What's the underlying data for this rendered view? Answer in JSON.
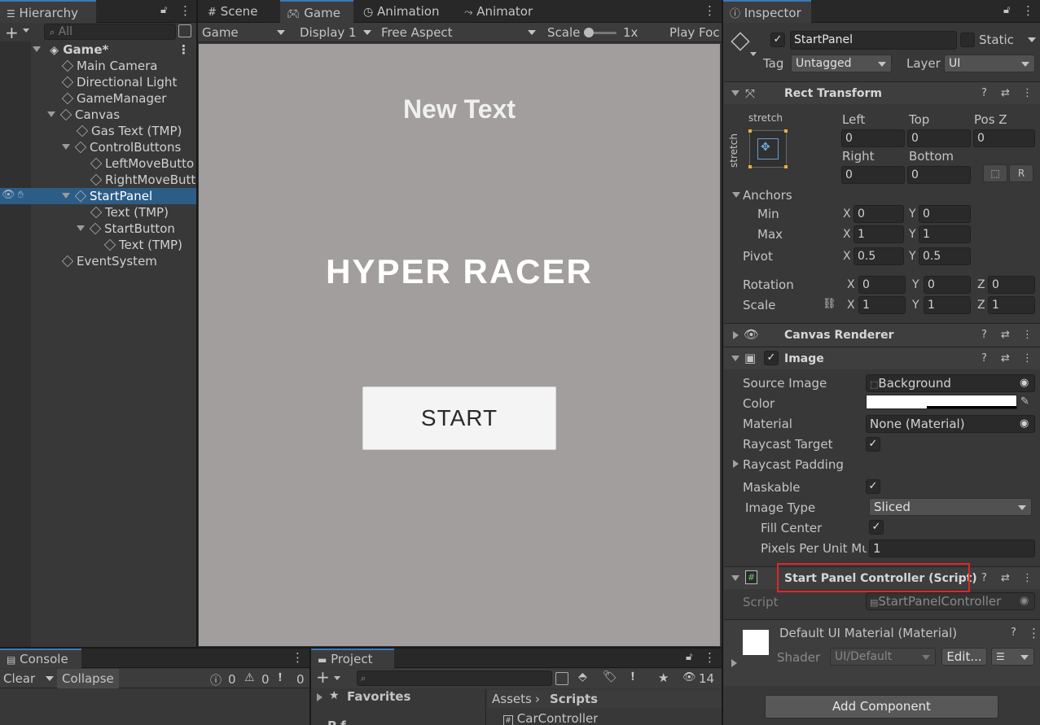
{
  "hierarchy": {
    "tab": "Hierarchy",
    "search_placeholder": "All",
    "scene": "Game*",
    "items": [
      "Main Camera",
      "Directional Light",
      "GameManager",
      "Canvas",
      "Gas Text (TMP)",
      "ControlButtons",
      "LeftMoveButto",
      "RightMoveButt",
      "StartPanel",
      "Text (TMP)",
      "StartButton",
      "Text (TMP)",
      "EventSystem"
    ]
  },
  "center": {
    "tabs": [
      "Scene",
      "Game",
      "Animation",
      "Animator"
    ],
    "toolbar": {
      "game_label": "Game",
      "display": "Display 1",
      "aspect": "Free Aspect",
      "scale_label": "Scale",
      "scale_value": "1x",
      "play_focus": "Play Foc"
    },
    "viewport": {
      "top_text": "New Text",
      "title": "HYPER RACER",
      "button": "START",
      "bg_color": "#a29e9e"
    }
  },
  "console": {
    "tab": "Console",
    "clear": "Clear",
    "collapse": "Collapse",
    "counts": [
      "0",
      "0",
      "0"
    ]
  },
  "project": {
    "tab": "Project",
    "favorites": "Favorites",
    "breadcrumb_root": "Assets",
    "breadcrumb_current": "Scripts",
    "count": "14",
    "file": "CarController",
    "partial": "P f"
  },
  "inspector": {
    "tab": "Inspector",
    "object_name": "StartPanel",
    "static_label": "Static",
    "tag_label": "Tag",
    "tag_value": "Untagged",
    "layer_label": "Layer",
    "layer_value": "UI",
    "rect": {
      "title": "Rect Transform",
      "stretch_h": "stretch",
      "stretch_v": "stretch",
      "left_label": "Left",
      "top_label": "Top",
      "posz_label": "Pos Z",
      "left": "0",
      "top": "0",
      "posz": "0",
      "right_label": "Right",
      "bottom_label": "Bottom",
      "right": "0",
      "bottom": "0",
      "anchors": "Anchors",
      "min": "Min",
      "max": "Max",
      "min_x": "0",
      "min_y": "0",
      "max_x": "1",
      "max_y": "1",
      "pivot": "Pivot",
      "pivot_x": "0.5",
      "pivot_y": "0.5",
      "rotation": "Rotation",
      "rot_x": "0",
      "rot_y": "0",
      "rot_z": "0",
      "scale": "Scale",
      "scale_x": "1",
      "scale_y": "1",
      "scale_z": "1"
    },
    "canvas_renderer": "Canvas Renderer",
    "image": {
      "title": "Image",
      "source_label": "Source Image",
      "source": "Background",
      "color_label": "Color",
      "material_label": "Material",
      "material": "None (Material)",
      "raycast_target": "Raycast Target",
      "raycast_padding": "Raycast Padding",
      "maskable": "Maskable",
      "image_type_label": "Image Type",
      "image_type": "Sliced",
      "fill_center": "Fill Center",
      "ppu_label": "Pixels Per Unit Mu",
      "ppu": "1"
    },
    "script": {
      "title": "Start Panel Controller (Script)",
      "script_label": "Script",
      "script_value": "StartPanelController"
    },
    "material": {
      "title": "Default UI Material (Material)",
      "shader_label": "Shader",
      "shader": "UI/Default",
      "edit": "Edit..."
    },
    "add_component": "Add Component"
  },
  "colors": {
    "accent": "#3a79bb",
    "selection": "#2c5d87",
    "highlight": "#e02626"
  }
}
